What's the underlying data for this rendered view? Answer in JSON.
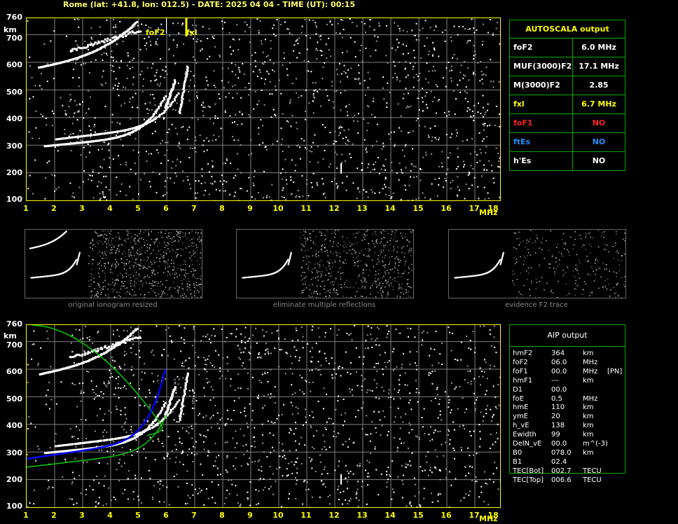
{
  "header": {
    "text": "Rome (lat: +41.8, lon: 012.5) - DATE: 2025 04 04 - TIME (UT): 00:15"
  },
  "axes": {
    "y_ticks": [
      "760",
      "700",
      "600",
      "500",
      "400",
      "300",
      "200",
      "100"
    ],
    "y_unit": "km",
    "x_ticks": [
      "1",
      "2",
      "3",
      "4",
      "5",
      "6",
      "7",
      "8",
      "9",
      "10",
      "11",
      "12",
      "13",
      "14",
      "15",
      "16",
      "17",
      "18"
    ],
    "x_unit": "MHz"
  },
  "markers": {
    "foF2": "foF2",
    "fxl": "fxl"
  },
  "autoscala": {
    "title": "AUTOSCALA output",
    "rows": [
      {
        "key": "foF2",
        "value": "6.0 MHz",
        "color": "#ffffff",
        "vcolor": "#ffffff"
      },
      {
        "key": "MUF(3000)F2",
        "value": "17.1 MHz",
        "color": "#ffffff",
        "vcolor": "#ffffff"
      },
      {
        "key": "M(3000)F2",
        "value": "2.85",
        "color": "#ffffff",
        "vcolor": "#ffffff"
      },
      {
        "key": "fxl",
        "value": "6.7 MHz",
        "color": "#ffff00",
        "vcolor": "#ffff00"
      },
      {
        "key": "foF1",
        "value": "NO",
        "color": "#ff2020",
        "vcolor": "#ff2020"
      },
      {
        "key": "ftEs",
        "value": "NO",
        "color": "#1e90ff",
        "vcolor": "#1e90ff"
      },
      {
        "key": "h'Es",
        "value": "NO",
        "color": "#ffffff",
        "vcolor": "#ffffff"
      }
    ]
  },
  "thumbnails": [
    {
      "caption": "original ionogram resized"
    },
    {
      "caption": "eliminate multiple reflections"
    },
    {
      "caption": "evidence F2 trace"
    }
  ],
  "aip": {
    "title": "AIP output",
    "rows": [
      [
        "hmF2",
        "364",
        "km",
        ""
      ],
      [
        "foF2",
        "06.0",
        "MHz",
        ""
      ],
      [
        "foF1",
        "00.0",
        "MHz",
        "[PN]"
      ],
      [
        "hmF1",
        "---",
        "km",
        ""
      ],
      [
        "D1",
        "00.0",
        "",
        ""
      ],
      [
        "foE",
        "0.5",
        "MHz",
        ""
      ],
      [
        "hmE",
        "110",
        "km",
        ""
      ],
      [
        "ymE",
        "20",
        "km",
        ""
      ],
      [
        "h_vE",
        "138",
        "km",
        ""
      ],
      [
        "Ewidth",
        "99",
        "km",
        ""
      ],
      [
        "DelN_vE",
        "00.0",
        "m^(-3)",
        ""
      ],
      [
        "B0",
        "078.0",
        "km",
        ""
      ],
      [
        "B1",
        "02.4",
        "",
        ""
      ],
      [
        "TEC[Bot]",
        "002.7",
        "TECU",
        ""
      ],
      [
        "TEC[Top]",
        "006.6",
        "TECU",
        ""
      ]
    ]
  },
  "colors": {
    "frame": "#ffff00",
    "grid": "#808080",
    "trace": "#ffffff",
    "profile": "#00cc00",
    "fit": "#0000ff",
    "table_border": "#00aa00"
  }
}
